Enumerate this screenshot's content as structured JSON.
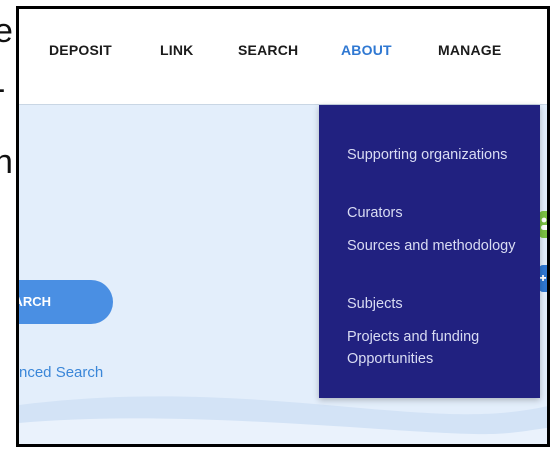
{
  "nav": {
    "items": [
      {
        "label": "DEPOSIT",
        "active": false
      },
      {
        "label": "LINK",
        "active": false
      },
      {
        "label": "SEARCH",
        "active": false
      },
      {
        "label": "ABOUT",
        "active": true
      },
      {
        "label": "MANAGE",
        "active": false
      }
    ]
  },
  "about_menu": {
    "items": [
      "Supporting organizations",
      "Curators",
      "Sources and methodology",
      "Subjects",
      "Projects and funding Opportunities"
    ]
  },
  "hero": {
    "search_button_label": "EARCH",
    "advanced_search_link": "nced Search"
  },
  "colors": {
    "accent": "#2f78d2",
    "menu_bg": "#212180",
    "hero_bg": "#e3eefb",
    "button": "#4a8fe3",
    "side_tab_green": "#7bc043",
    "side_tab_blue": "#2f78d2"
  },
  "side_tabs": [
    {
      "icon": "users-icon"
    },
    {
      "icon": "add-user-icon"
    }
  ]
}
